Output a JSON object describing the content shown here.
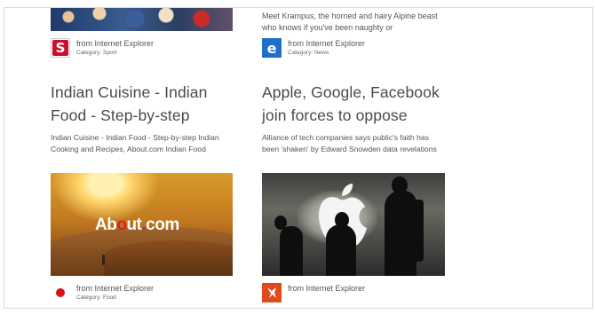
{
  "tiles": {
    "left_top": {
      "source": "from Internet Explorer",
      "category": "Category: Sport",
      "icon": "sport-logo-icon"
    },
    "right_top": {
      "snippet": "Meet Krampus, the horned and hairy Alpine beast who knows if you've been naughty or",
      "source": "from Internet Explorer",
      "category": "Category: News",
      "icon": "internet-explorer-icon"
    },
    "left_main": {
      "headline": "Indian Cuisine - Indian Food - Step-by-step",
      "description": "Indian Cuisine - Indian Food - Step-by-step Indian Cooking and Recipes, About.com Indian Food",
      "image_logo": {
        "part1": "Ab",
        "part2": "o",
        "part3": "ut",
        "part4": "com"
      },
      "source": "from Internet Explorer",
      "category": "Category: Food",
      "icon": "red-dot-icon",
      "colors": {
        "accent": "#d11111"
      }
    },
    "right_main": {
      "headline": "Apple, Google, Facebook join forces to oppose",
      "description": "Alliance of tech companies says public's faith has been 'shaken' by Edward Snowden data revelations",
      "source": "from Internet Explorer",
      "icon": "news-site-icon",
      "colors": {
        "accent": "#e04a1a"
      }
    }
  }
}
